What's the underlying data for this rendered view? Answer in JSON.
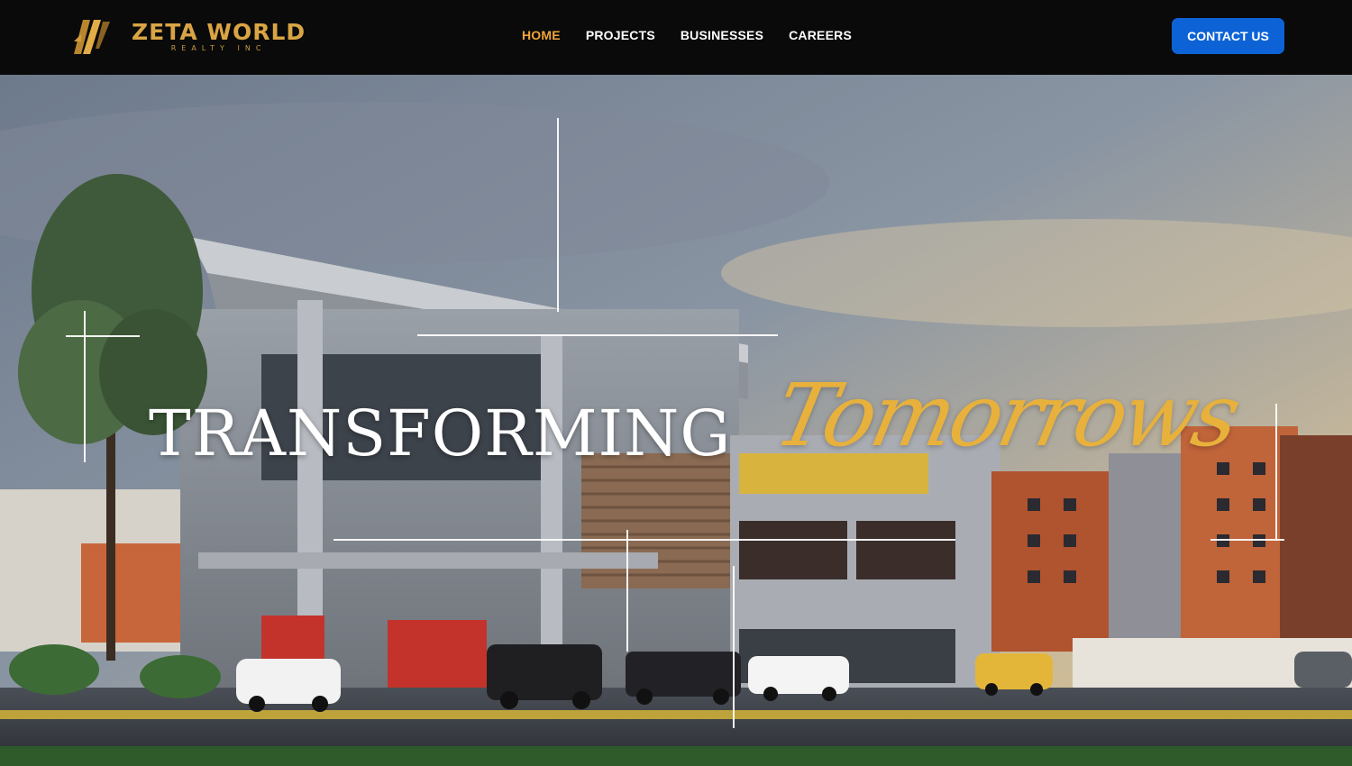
{
  "header": {
    "logo": {
      "name": "ZETA WORLD",
      "subtitle": "REALTY INC"
    },
    "nav": [
      {
        "label": "HOME",
        "active": true
      },
      {
        "label": "PROJECTS",
        "active": false
      },
      {
        "label": "BUSINESSES",
        "active": false
      },
      {
        "label": "CAREERS",
        "active": false
      }
    ],
    "contact_label": "CONTACT US"
  },
  "hero": {
    "title": "TRANSFORMING",
    "script": "Tomorrows"
  },
  "colors": {
    "header_bg": "#0a0a0a",
    "accent_gold": "#e8b13c",
    "nav_active": "#f0a53a",
    "button_blue": "#0d63d6"
  }
}
